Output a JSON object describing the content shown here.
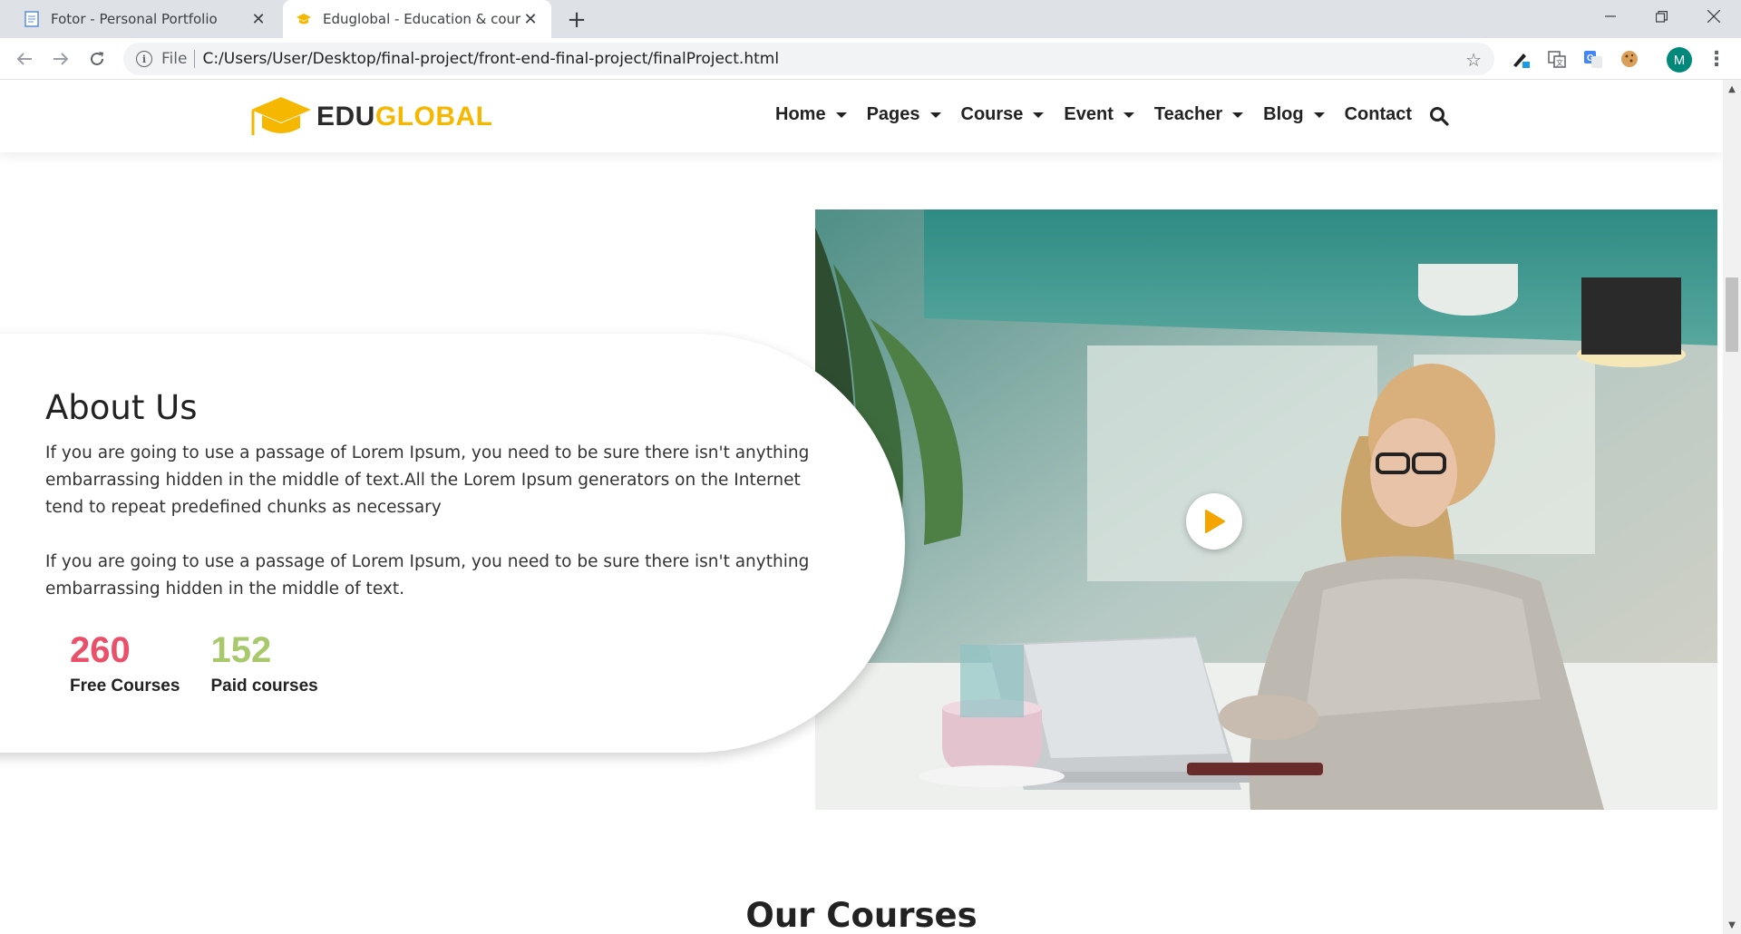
{
  "browser": {
    "tabs": [
      {
        "title": "Fotor - Personal Portfolio",
        "favicon": "document-icon",
        "active": false
      },
      {
        "title": "Eduglobal - Education & course",
        "favicon": "graduation-cap-icon",
        "active": true
      }
    ],
    "address": {
      "scheme": "File",
      "url": "C:/Users/User/Desktop/final-project/front-end-final-project/finalProject.html"
    },
    "profile_initial": "M",
    "extensions": [
      "pen-extension-icon",
      "translate-extension-icon",
      "google-translate-icon",
      "cookie-extension-icon"
    ]
  },
  "site": {
    "logo": {
      "part1": "EDU",
      "part2": "GLOBAL",
      "colors": {
        "part1": "#2b2b2b",
        "part2": "#f5b700"
      }
    },
    "nav": [
      {
        "label": "Home",
        "dropdown": true
      },
      {
        "label": "Pages",
        "dropdown": true
      },
      {
        "label": "Course",
        "dropdown": true
      },
      {
        "label": "Event",
        "dropdown": true
      },
      {
        "label": "Teacher",
        "dropdown": true
      },
      {
        "label": "Blog",
        "dropdown": true
      },
      {
        "label": "Contact",
        "dropdown": false
      }
    ],
    "search_icon": "search-icon"
  },
  "about": {
    "title": "About Us",
    "paragraph1": "If you are going to use a passage of Lorem Ipsum, you need to be sure there isn't anything embarrassing hidden in the middle of text.All the Lorem Ipsum generators on the Internet tend to repeat predefined chunks as necessary",
    "paragraph2": "If you are going to use a passage of Lorem Ipsum, you need to be sure there isn't anything embarrassing hidden in the middle of text.",
    "stats": [
      {
        "value": "260",
        "label": "Free Courses",
        "color": "#ea5069"
      },
      {
        "value": "152",
        "label": "Paid courses",
        "color": "#a7c96b"
      }
    ]
  },
  "media": {
    "play_icon": "play-icon",
    "accent": "#f5b700"
  },
  "courses": {
    "title": "Our Courses"
  }
}
